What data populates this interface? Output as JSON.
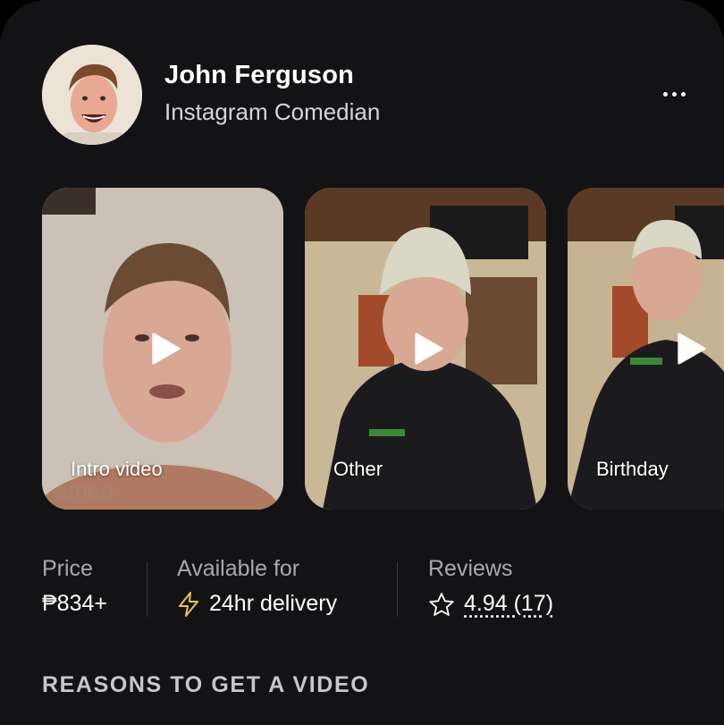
{
  "profile": {
    "name": "John Ferguson",
    "subtitle": "Instagram Comedian",
    "avatar_icon": "user-photo",
    "more_icon": "ellipsis-horizontal-icon"
  },
  "videos": [
    {
      "label": "Intro video",
      "icon": "play-icon"
    },
    {
      "label": "Other",
      "icon": "play-icon"
    },
    {
      "label": "Birthday",
      "icon": "play-icon"
    }
  ],
  "stats": {
    "price": {
      "label": "Price",
      "value": "₱834+"
    },
    "availability": {
      "label": "Available for",
      "value": "24hr delivery",
      "icon": "lightning-icon"
    },
    "reviews": {
      "label": "Reviews",
      "value": "4.94 (17)",
      "icon": "star-outline-icon"
    }
  },
  "section": {
    "title": "REASONS TO GET A VIDEO"
  },
  "colors": {
    "background": "#131316",
    "accent_lightning": "#e8c84a",
    "text_primary": "#ffffff",
    "text_secondary": "#a9a9ae"
  }
}
